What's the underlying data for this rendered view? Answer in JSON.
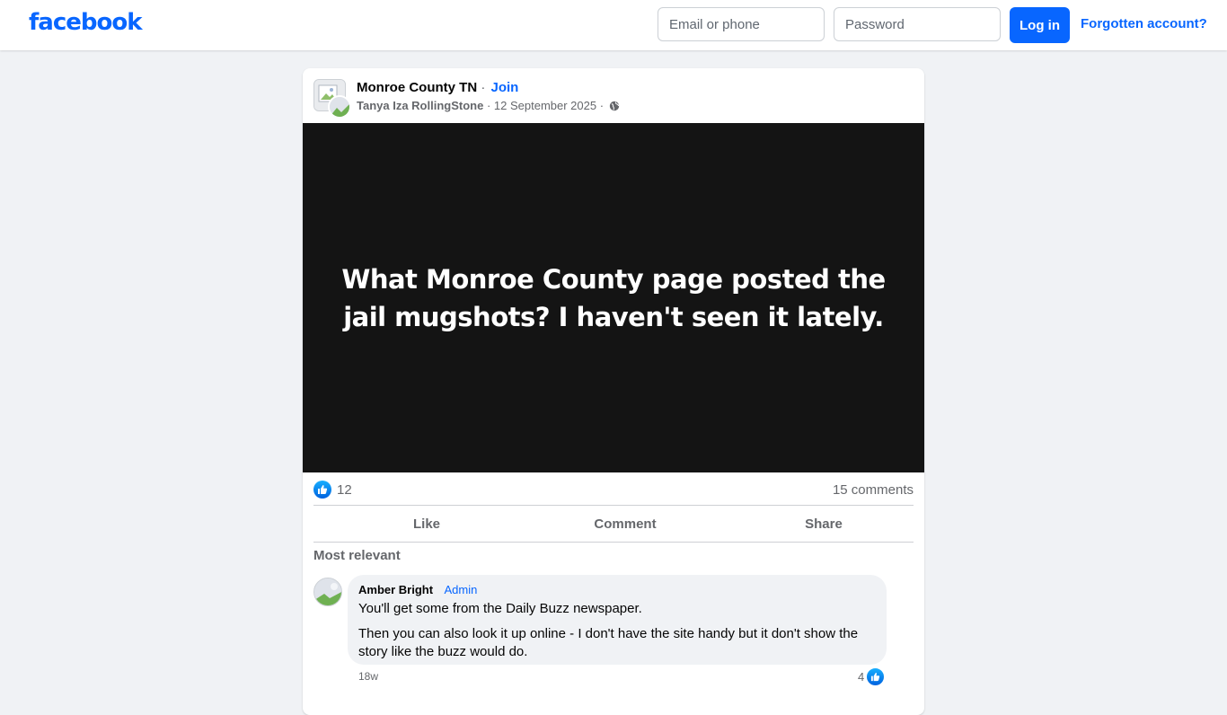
{
  "header": {
    "logo": "facebook",
    "email_placeholder": "Email or phone",
    "password_placeholder": "Password",
    "login_label": "Log in",
    "forgot_label": "Forgotten account?"
  },
  "post": {
    "group_name": "Monroe County TN",
    "separator": " · ",
    "join_label": "Join",
    "author": "Tanya Iza RollingStone",
    "date": "12 September 2025",
    "date_separator": " · ",
    "text": "What Monroe County page posted the jail mugshots? I haven't seen it lately.",
    "background_color": "#141414",
    "reaction_count": "12",
    "comment_count": "15 comments",
    "actions": {
      "like": "Like",
      "comment": "Comment",
      "share": "Share"
    },
    "sort_label": "Most relevant"
  },
  "comments": [
    {
      "name": "Amber Bright",
      "role": "Admin",
      "lines": [
        "You'll get some from the Daily Buzz newspaper.",
        "Then you can also look it up online - I don't have the site handy but it don't show the story like the buzz would do."
      ],
      "time": "18w",
      "reactions": "4"
    }
  ],
  "colors": {
    "brand": "#0866ff",
    "background": "#f0f2f5",
    "secondary_text": "#65676b"
  },
  "icons": {
    "reaction": "like-icon",
    "privacy": "globe-icon"
  }
}
